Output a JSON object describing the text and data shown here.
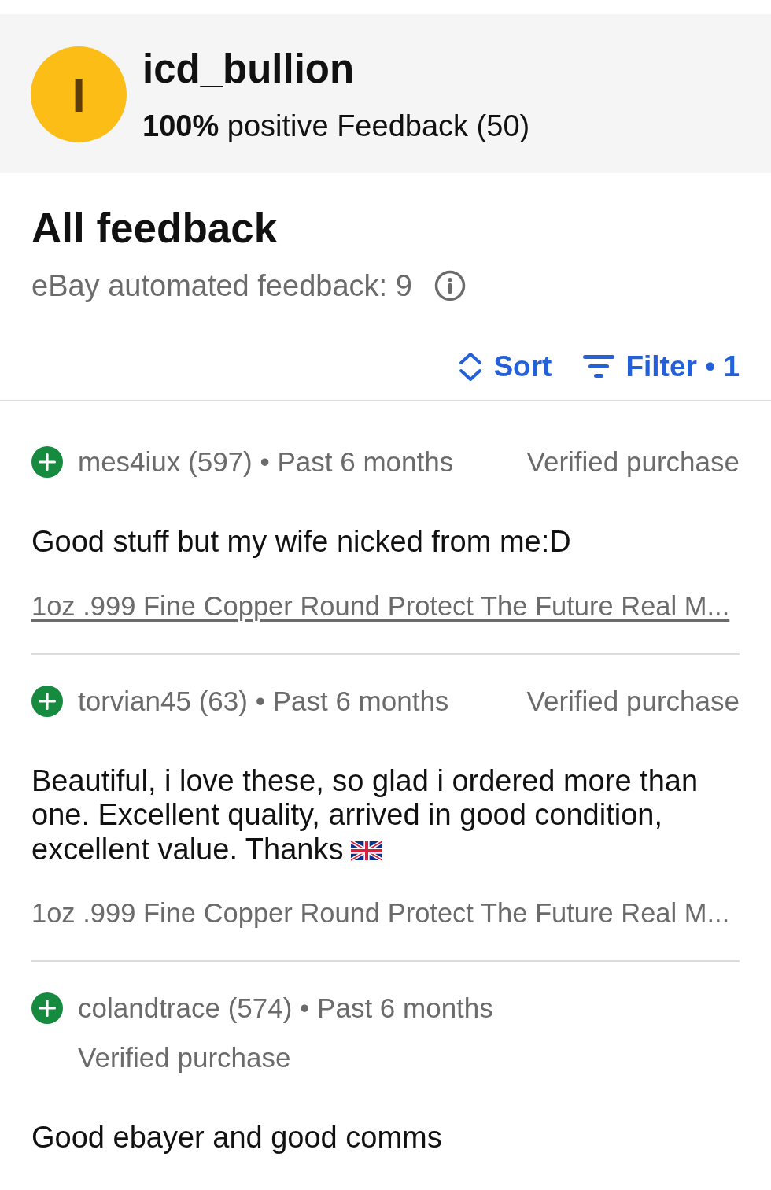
{
  "profile": {
    "avatar_letter": "I",
    "username": "icd_bullion",
    "rating": "**100%** positive Feedback (50)"
  },
  "summary": {
    "title": "All feedback",
    "automated": "eBay automated feedback: 9"
  },
  "toolbar": {
    "sort": "Sort",
    "filter": "Filter • 1"
  },
  "feedback": [
    {
      "kind": "positive",
      "byline": "mes4iux (597) • Past 6 months",
      "verified": "Verified purchase",
      "comment": "Good stuff but my wife nicked from me:D",
      "item": "1oz .999 Fine Copper Round Protect The Future Real M...",
      "focused": true
    },
    {
      "kind": "positive",
      "byline": "torvian45 (63) • Past 6 months",
      "verified": "Verified purchase",
      "comment": "Beautiful, i love these, so glad i ordered more than one. Excellent quality, arrived in good condition, excellent value. Thanks",
      "flag_emoji": true,
      "item": "1oz .999 Fine Copper Round Protect The Future Real M...",
      "focused": false
    },
    {
      "kind": "positive",
      "byline": "colandtrace (574) • Past 6 months",
      "verified": "Verified purchase",
      "comment": "Good ebayer and good comms"
    }
  ]
}
